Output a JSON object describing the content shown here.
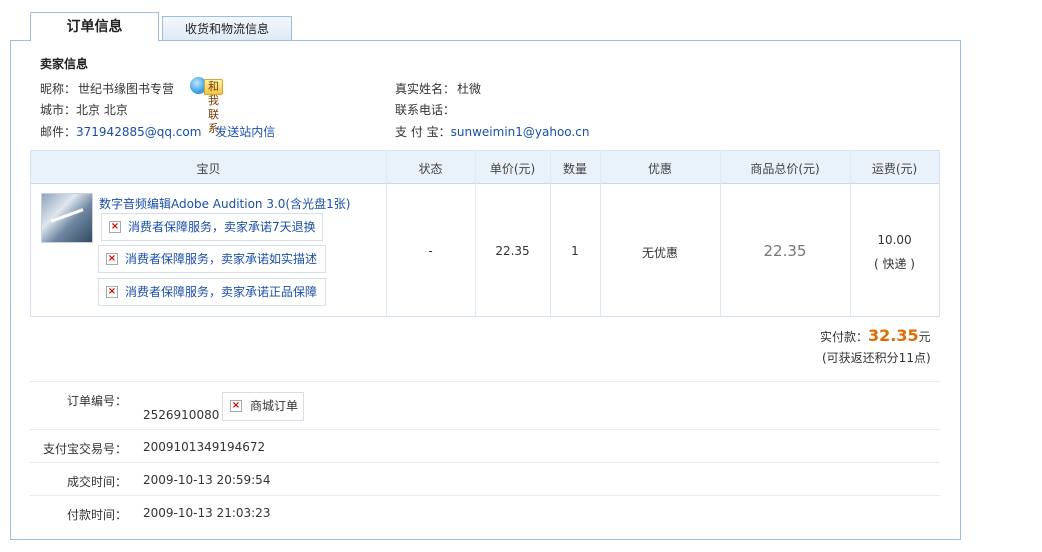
{
  "tabs": {
    "active": "订单信息",
    "inactive": "收货和物流信息"
  },
  "seller": {
    "section_title": "卖家信息",
    "nickname_label": "昵称：",
    "nickname": "世纪书缘图书专营",
    "contact_button": "和我联系",
    "city_label": "城市：",
    "city": "北京 北京",
    "email_label": "邮件：",
    "email": "371942885@qq.com",
    "send_message": "发送站内信",
    "realname_label": "真实姓名：",
    "realname": "杜微",
    "phone_label": "联系电话：",
    "phone": "",
    "alipay_label": "支 付 宝：",
    "alipay": "sunweimin1@yahoo.cn"
  },
  "table": {
    "headers": [
      "宝贝",
      "状态",
      "单价(元)",
      "数量",
      "优惠",
      "商品总价(元)",
      "运费(元)"
    ],
    "item": {
      "title": "数字音频编辑Adobe Audition 3.0(含光盘1张)",
      "guarantees": [
        "消费者保障服务，卖家承诺7天退换",
        "消费者保障服务，卖家承诺如实描述",
        "消费者保障服务，卖家承诺正品保障"
      ],
      "status": "-",
      "unit_price": "22.35",
      "quantity": "1",
      "discount": "无优惠",
      "total": "22.35",
      "shipping": "10.00",
      "shipping_method": "( 快递 )"
    }
  },
  "payment": {
    "paid_label": "实付款：",
    "paid_amount": "32.35",
    "paid_unit": "元",
    "points_note": "(可获返还积分11点)"
  },
  "order": {
    "number_label": "订单编号：",
    "number": "2526910080",
    "mall_tag": "商城订单",
    "alipay_txn_label": "支付宝交易号：",
    "alipay_txn": "2009101349194672",
    "deal_time_label": "成交时间：",
    "deal_time": "2009-10-13 20:59:54",
    "pay_time_label": "付款时间：",
    "pay_time": "2009-10-13 21:03:23"
  },
  "colors": {
    "accent_link": "#1a4fa8",
    "amount_orange": "#e06b00",
    "header_bg": "#e9f1fb",
    "border_blue": "#9bbde0"
  }
}
